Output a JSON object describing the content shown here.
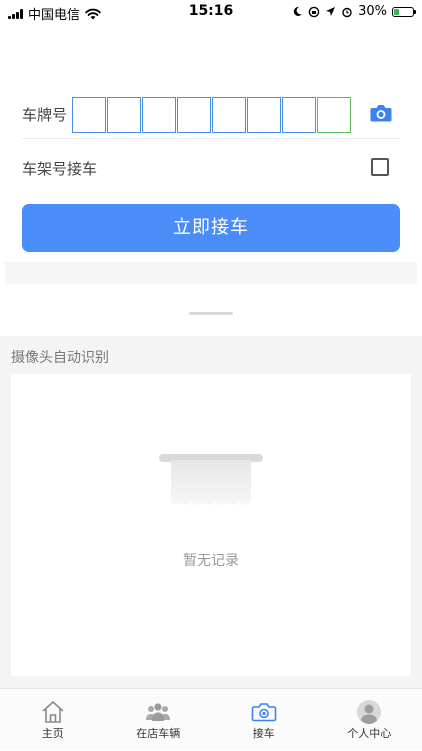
{
  "status_bar": {
    "carrier": "中国电信",
    "time": "15:16",
    "battery_text": "30%",
    "battery_level": 0.3
  },
  "form": {
    "plate_label": "车牌号",
    "plate_chars": [
      "",
      "",
      "",
      "",
      "",
      "",
      "",
      ""
    ],
    "vin_label": "车架号接车",
    "vin_checked": false,
    "submit_label": "立即接车"
  },
  "recognition": {
    "title": "摄像头自动识别",
    "empty_text": "暂无记录"
  },
  "tabbar": {
    "tabs": [
      {
        "label": "主页",
        "icon": "home-icon"
      },
      {
        "label": "在店车辆",
        "icon": "people-icon"
      },
      {
        "label": "接车",
        "icon": "camera-icon",
        "active": true
      },
      {
        "label": "个人中心",
        "icon": "user-icon"
      }
    ]
  },
  "colors": {
    "accent": "#4a8df8",
    "plate_border": "#4a90e2",
    "nev_border": "#5cb85c"
  }
}
